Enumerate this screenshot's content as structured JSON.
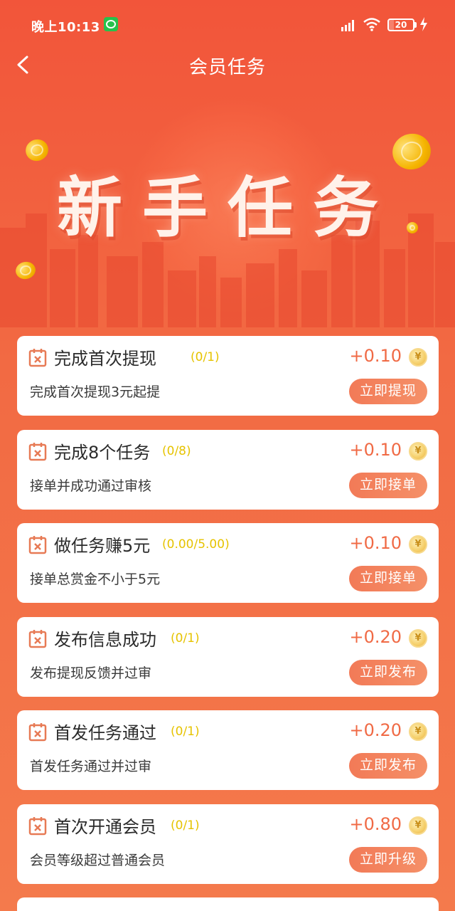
{
  "status_bar": {
    "time": "晚上10:13",
    "battery": "20",
    "icons": [
      "wechat-icon",
      "signal-icon",
      "wifi-icon",
      "battery-icon",
      "charging-icon"
    ]
  },
  "nav": {
    "title": "会员任务",
    "back_icon": "chevron-left-icon"
  },
  "banner": {
    "headline": "新手任务"
  },
  "tasks": [
    {
      "title": "完成首次提现",
      "progress": "(0/1)",
      "reward": "+0.10",
      "desc": "完成首次提现3元起提",
      "action": "立即提现"
    },
    {
      "title": "完成8个任务",
      "progress": "(0/8)",
      "reward": "+0.10",
      "desc": "接单并成功通过审核",
      "action": "立即接单"
    },
    {
      "title": "做任务赚5元",
      "progress": "(0.00/5.00)",
      "reward": "+0.10",
      "desc": "接单总赏金不小于5元",
      "action": "立即接单"
    },
    {
      "title": "发布信息成功",
      "progress": "(0/1)",
      "reward": "+0.20",
      "desc": "发布提现反馈并过审",
      "action": "立即发布"
    },
    {
      "title": "首发任务通过",
      "progress": "(0/1)",
      "reward": "+0.20",
      "desc": "首发任务通过并过审",
      "action": "立即发布"
    },
    {
      "title": "首次开通会员",
      "progress": "(0/1)",
      "reward": "+0.80",
      "desc": "会员等级超过普通会员",
      "action": "立即升级"
    }
  ],
  "coin_symbol": "¥",
  "colors": {
    "background": "#f2553a",
    "reward": "#f06a45",
    "progress": "#e6c300",
    "action_button": "#f27a57",
    "card": "#ffffff"
  }
}
